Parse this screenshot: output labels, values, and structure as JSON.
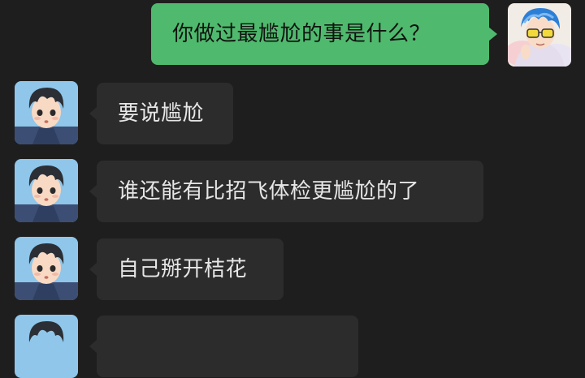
{
  "chat": {
    "messages": [
      {
        "sender": "me",
        "avatar": "avatar-blue-hair-glasses",
        "text": "你做过最尴尬的事是什么？"
      },
      {
        "sender": "other",
        "avatar": "avatar-dark-hair-boy",
        "text": "要说尴尬"
      },
      {
        "sender": "other",
        "avatar": "avatar-dark-hair-boy",
        "text": "谁还能有比招飞体检更尴尬的了"
      },
      {
        "sender": "other",
        "avatar": "avatar-dark-hair-boy",
        "text": "自己掰开桔花"
      },
      {
        "sender": "other",
        "avatar": "avatar-dark-hair-boy",
        "text": ""
      }
    ]
  },
  "colors": {
    "background": "#1e1e1e",
    "bubble_other": "#2c2c2c",
    "bubble_me": "#4fba6e",
    "text_other": "#e6e6e6",
    "text_me": "#101410"
  }
}
